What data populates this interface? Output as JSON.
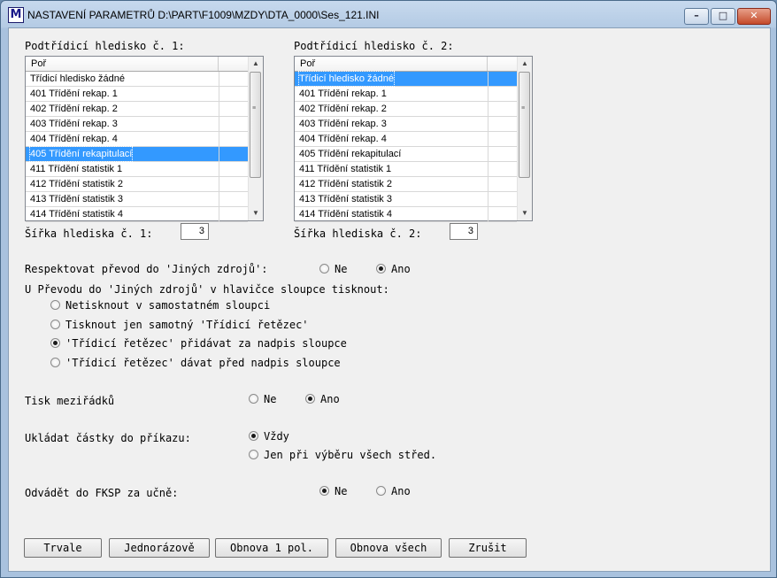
{
  "window": {
    "title": "NASTAVENÍ PARAMETRŮ  D:\\PART\\F1009\\MZDY\\DTA_0000\\Ses_121.INI",
    "icon": "M",
    "controls": {
      "minimize": "–",
      "maximize": "□",
      "close": "✕"
    }
  },
  "list1": {
    "label": "Podtřídicí hledisko č. 1:",
    "header": "Poř",
    "items": [
      "Třídicí hledisko žádné",
      "401 Třídění rekap. 1",
      "402 Třídění rekap. 2",
      "403 Třídění rekap. 3",
      "404 Třídění rekap. 4",
      "405 Třídění rekapitulací",
      "411 Třídění statistik 1",
      "412 Třídění statistik 2",
      "413 Třídění statistik 3",
      "414 Třídění statistik 4"
    ],
    "selected_index": 5,
    "width_label": "Šířka hlediska č. 1:",
    "width_value": "3"
  },
  "list2": {
    "label": "Podtřídicí hledisko č. 2:",
    "header": "Poř",
    "items": [
      "Třídicí hledisko žádné",
      "401 Třídění rekap. 1",
      "402 Třídění rekap. 2",
      "403 Třídění rekap. 3",
      "404 Třídění rekap. 4",
      "405 Třídění rekapitulací",
      "411 Třídění statistik 1",
      "412 Třídění statistik 2",
      "413 Třídění statistik 3",
      "414 Třídění statistik 4"
    ],
    "selected_index": 0,
    "width_label": "Šířka hlediska č. 2:",
    "width_value": "3"
  },
  "respektovat": {
    "label": "Respektovat převod do 'Jiných zdrojů':",
    "ne": "Ne",
    "ano": "Ano",
    "selected": "ano"
  },
  "hlavicka": {
    "label": "U Převodu do 'Jiných zdrojů' v hlavičce sloupce tisknout:",
    "options": [
      "Netisknout v samostatném sloupci",
      "Tisknout jen samotný 'Třídicí řetězec'",
      "'Třídicí řetězec' přidávat za nadpis sloupce",
      "'Třídicí řetězec' dávat před nadpis sloupce"
    ],
    "selected_index": 2
  },
  "tisk": {
    "label": "Tisk meziřádků",
    "ne": "Ne",
    "ano": "Ano",
    "selected": "ano"
  },
  "ukladat": {
    "label": "Ukládat částky do příkazu:",
    "opt1": "Vždy",
    "opt2": "Jen při výběru všech střed.",
    "selected": "opt1"
  },
  "fksp": {
    "label": "Odvádět do FKSP za učně:",
    "ne": "Ne",
    "ano": "Ano",
    "selected": "ne"
  },
  "buttons": {
    "trvale": "Trvale",
    "jednorazove": "Jednorázově",
    "obnova1": "Obnova 1 pol.",
    "obnova_vse": "Obnova všech",
    "zrusit": "Zrušit"
  }
}
